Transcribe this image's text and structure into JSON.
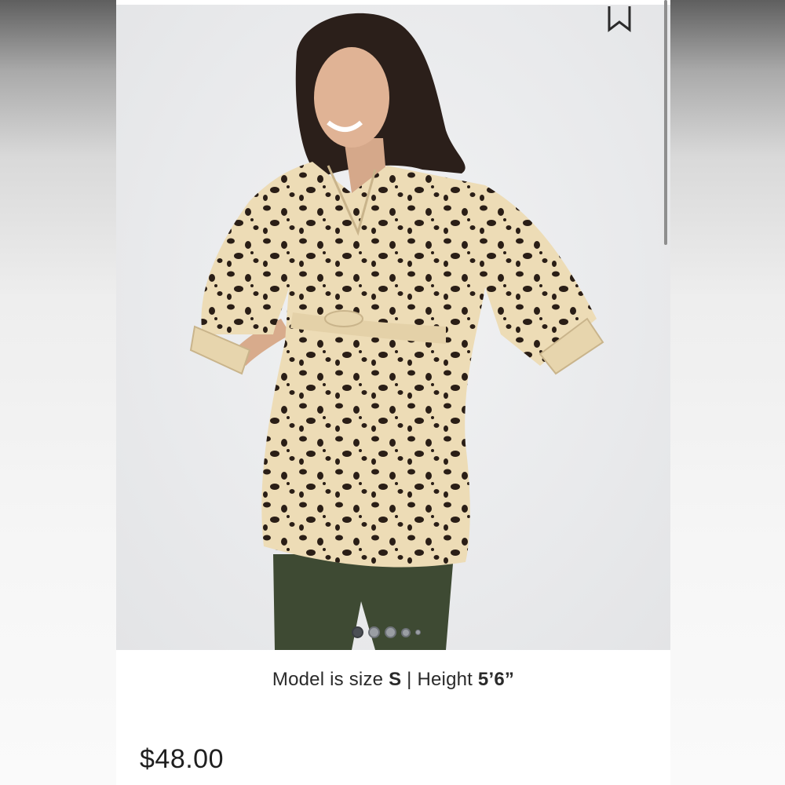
{
  "product": {
    "image_alt": "Model wearing cream dotted maternity tunic",
    "model_size_prefix": "Model is size ",
    "model_size": "S",
    "separator": " | Height ",
    "model_height": "5’6”",
    "price": "$48.00"
  },
  "gallery": {
    "image_count": 5,
    "current_index": 0
  },
  "colors": {
    "top": "#eddcb6",
    "spots": "#2a1e16",
    "pants": "#3e4a33"
  },
  "icons": {
    "save": "bookmark-icon"
  }
}
